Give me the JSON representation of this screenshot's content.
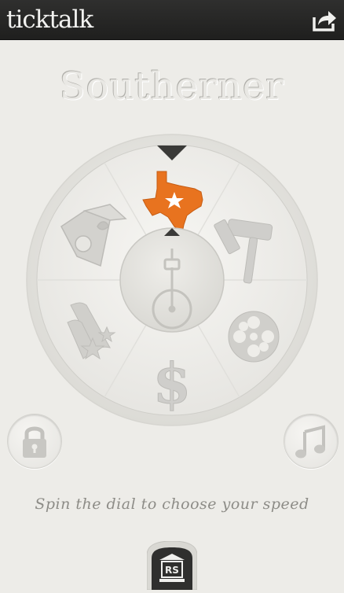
{
  "header": {
    "logo_text": "ticktalk",
    "share_icon": "share-icon"
  },
  "title": "Southerner",
  "dial": {
    "selected_segment": "texas",
    "segments": [
      "texas-icon",
      "gavel-icon",
      "film-reel-icon",
      "dollar-icon",
      "stars-stripes-icon",
      "book-icon"
    ],
    "center_icon": "metronome-icon",
    "accent_color": "#e8731f"
  },
  "buttons": {
    "lock_icon": "lock-icon",
    "music_icon": "music-note-icon"
  },
  "hint": "Spin the dial to choose your speed",
  "bottom_tab": {
    "label": "RS"
  }
}
